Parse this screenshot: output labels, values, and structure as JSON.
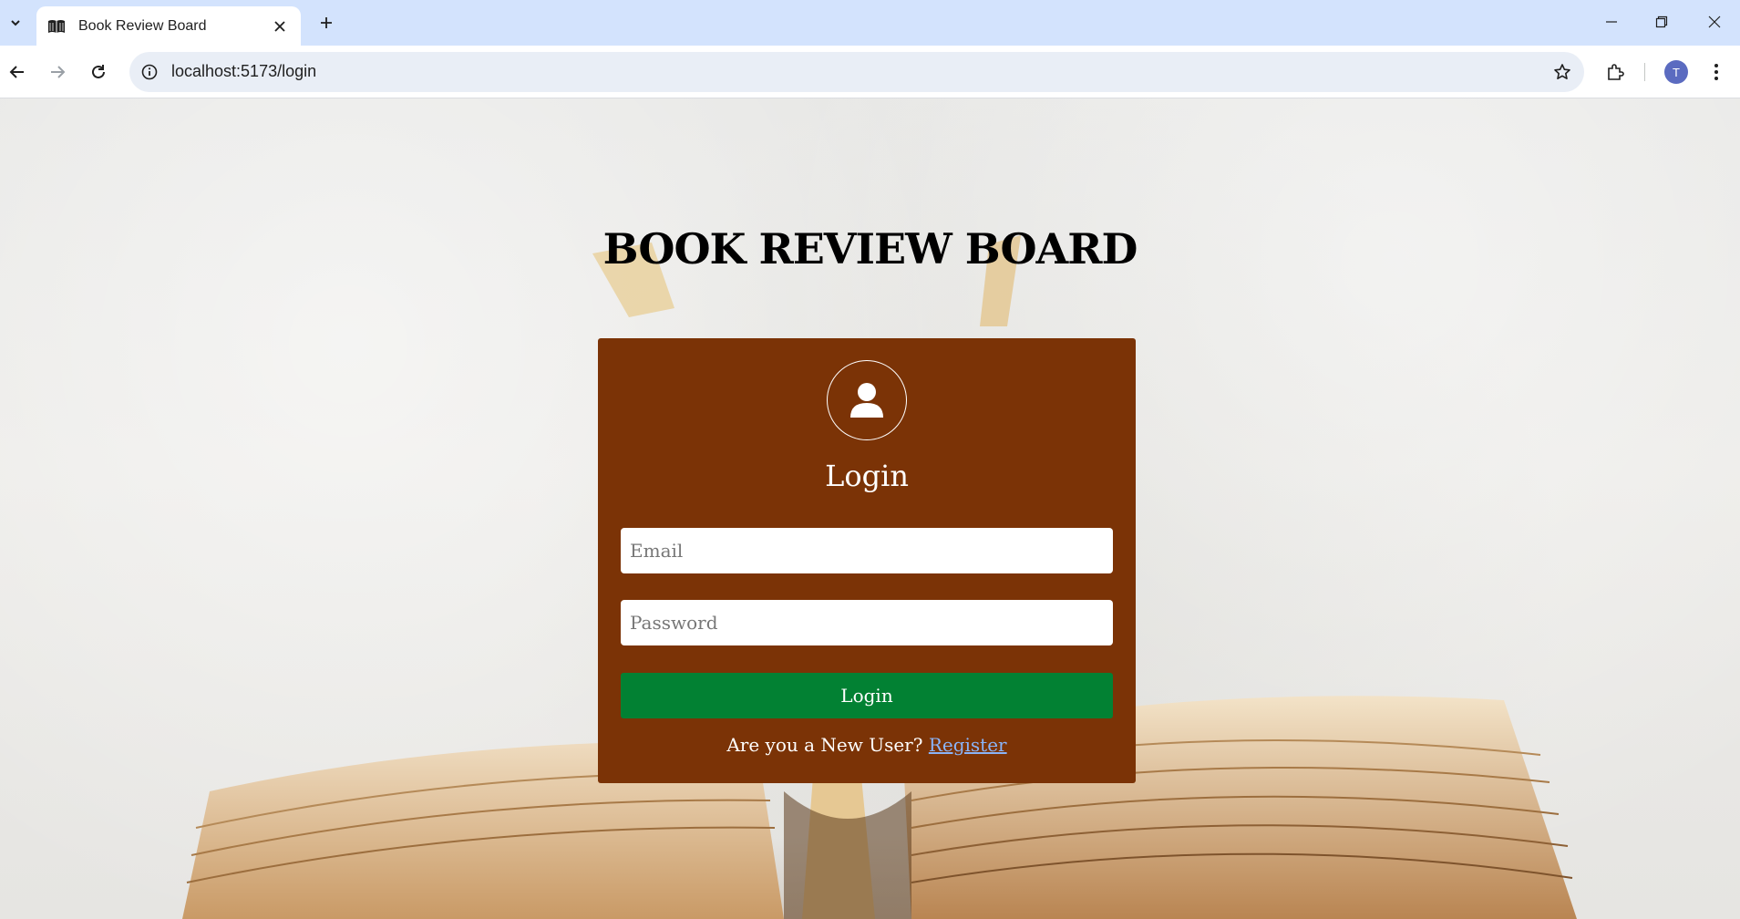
{
  "browser": {
    "tab_title": "Book Review Board",
    "url": "localhost:5173/login",
    "profile_initial": "T"
  },
  "page": {
    "heading": "BOOK REVIEW BOARD"
  },
  "login_card": {
    "title": "Login",
    "email_placeholder": "Email",
    "password_placeholder": "Password",
    "submit_label": "Login",
    "new_user_text": "Are you a New User?",
    "register_link": "Register"
  },
  "colors": {
    "card_background": "#7b3306",
    "login_button": "#028133",
    "register_link": "#8ab4f8",
    "tabbar": "#d3e3fd"
  }
}
